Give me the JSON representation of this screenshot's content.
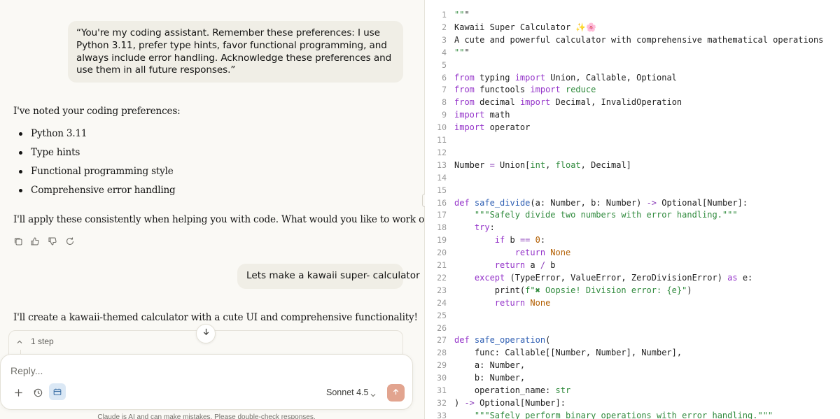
{
  "chat": {
    "user_message_1": "“You're my coding assistant. Remember these preferences: I use Python 3.11, prefer type hints, favor functional programming, and always include error handling. Acknowledge these preferences and use them in all future responses.”",
    "assistant_intro": "I've noted your coding preferences:",
    "preferences": [
      "Python 3.11",
      "Type hints",
      "Functional programming style",
      "Comprehensive error handling"
    ],
    "assistant_outro": "I'll apply these consistently when helping you with code. What would you like to work on?",
    "action_icons": [
      "copy-icon",
      "thumbs-up-icon",
      "thumbs-down-icon",
      "retry-icon"
    ],
    "user_message_2": "Lets make a kawaii super- calculator",
    "assistant_reply_2": "I'll create a kawaii-themed calculator with a cute UI and comprehensive functionality!",
    "step_label": "1 step"
  },
  "composer": {
    "placeholder": "Reply...",
    "model": "Sonnet 4.5",
    "icons": [
      "plus-icon",
      "history-icon",
      "tool-icon",
      "send-arrow-icon"
    ],
    "disclaimer": "Claude is AI and can make mistakes. Please double-check responses."
  },
  "code": {
    "lines": [
      {
        "n": "1",
        "src": "\"\"\""
      },
      {
        "n": "2",
        "src": "Kawaii Super Calculator ✨🌸"
      },
      {
        "n": "3",
        "src": "A cute and powerful calculator with comprehensive mathematical operations"
      },
      {
        "n": "4",
        "src": "\"\"\""
      },
      {
        "n": "5",
        "src": ""
      },
      {
        "n": "6",
        "src": "from typing import Union, Callable, Optional"
      },
      {
        "n": "7",
        "src": "from functools import reduce"
      },
      {
        "n": "8",
        "src": "from decimal import Decimal, InvalidOperation"
      },
      {
        "n": "9",
        "src": "import math"
      },
      {
        "n": "10",
        "src": "import operator"
      },
      {
        "n": "11",
        "src": ""
      },
      {
        "n": "12",
        "src": ""
      },
      {
        "n": "13",
        "src": "Number = Union[int, float, Decimal]"
      },
      {
        "n": "14",
        "src": ""
      },
      {
        "n": "15",
        "src": ""
      },
      {
        "n": "16",
        "src": "def safe_divide(a: Number, b: Number) -> Optional[Number]:"
      },
      {
        "n": "17",
        "src": "    \"\"\"Safely divide two numbers with error handling.\"\"\""
      },
      {
        "n": "18",
        "src": "    try:"
      },
      {
        "n": "19",
        "src": "        if b == 0:"
      },
      {
        "n": "20",
        "src": "            return None"
      },
      {
        "n": "21",
        "src": "        return a / b"
      },
      {
        "n": "22",
        "src": "    except (TypeError, ValueError, ZeroDivisionError) as e:"
      },
      {
        "n": "23",
        "src": "        print(f\"✖ Oopsie! Division error: {e}\")"
      },
      {
        "n": "24",
        "src": "        return None"
      },
      {
        "n": "25",
        "src": ""
      },
      {
        "n": "26",
        "src": ""
      },
      {
        "n": "27",
        "src": "def safe_operation("
      },
      {
        "n": "28",
        "src": "    func: Callable[[Number, Number], Number],"
      },
      {
        "n": "29",
        "src": "    a: Number,"
      },
      {
        "n": "30",
        "src": "    b: Number,"
      },
      {
        "n": "31",
        "src": "    operation_name: str"
      },
      {
        "n": "32",
        "src": ") -> Optional[Number]:"
      },
      {
        "n": "33",
        "src": "    \"\"\"Safely perform binary operations with error handling.\"\"\""
      }
    ]
  },
  "colors": {
    "background": "#faf9f5",
    "user_bubble": "#f0eee6",
    "send_button": "#e2a48f",
    "keyword": "#9433c9",
    "function": "#2f5fb3",
    "string": "#2f8a3c",
    "number": "#b25e00"
  }
}
